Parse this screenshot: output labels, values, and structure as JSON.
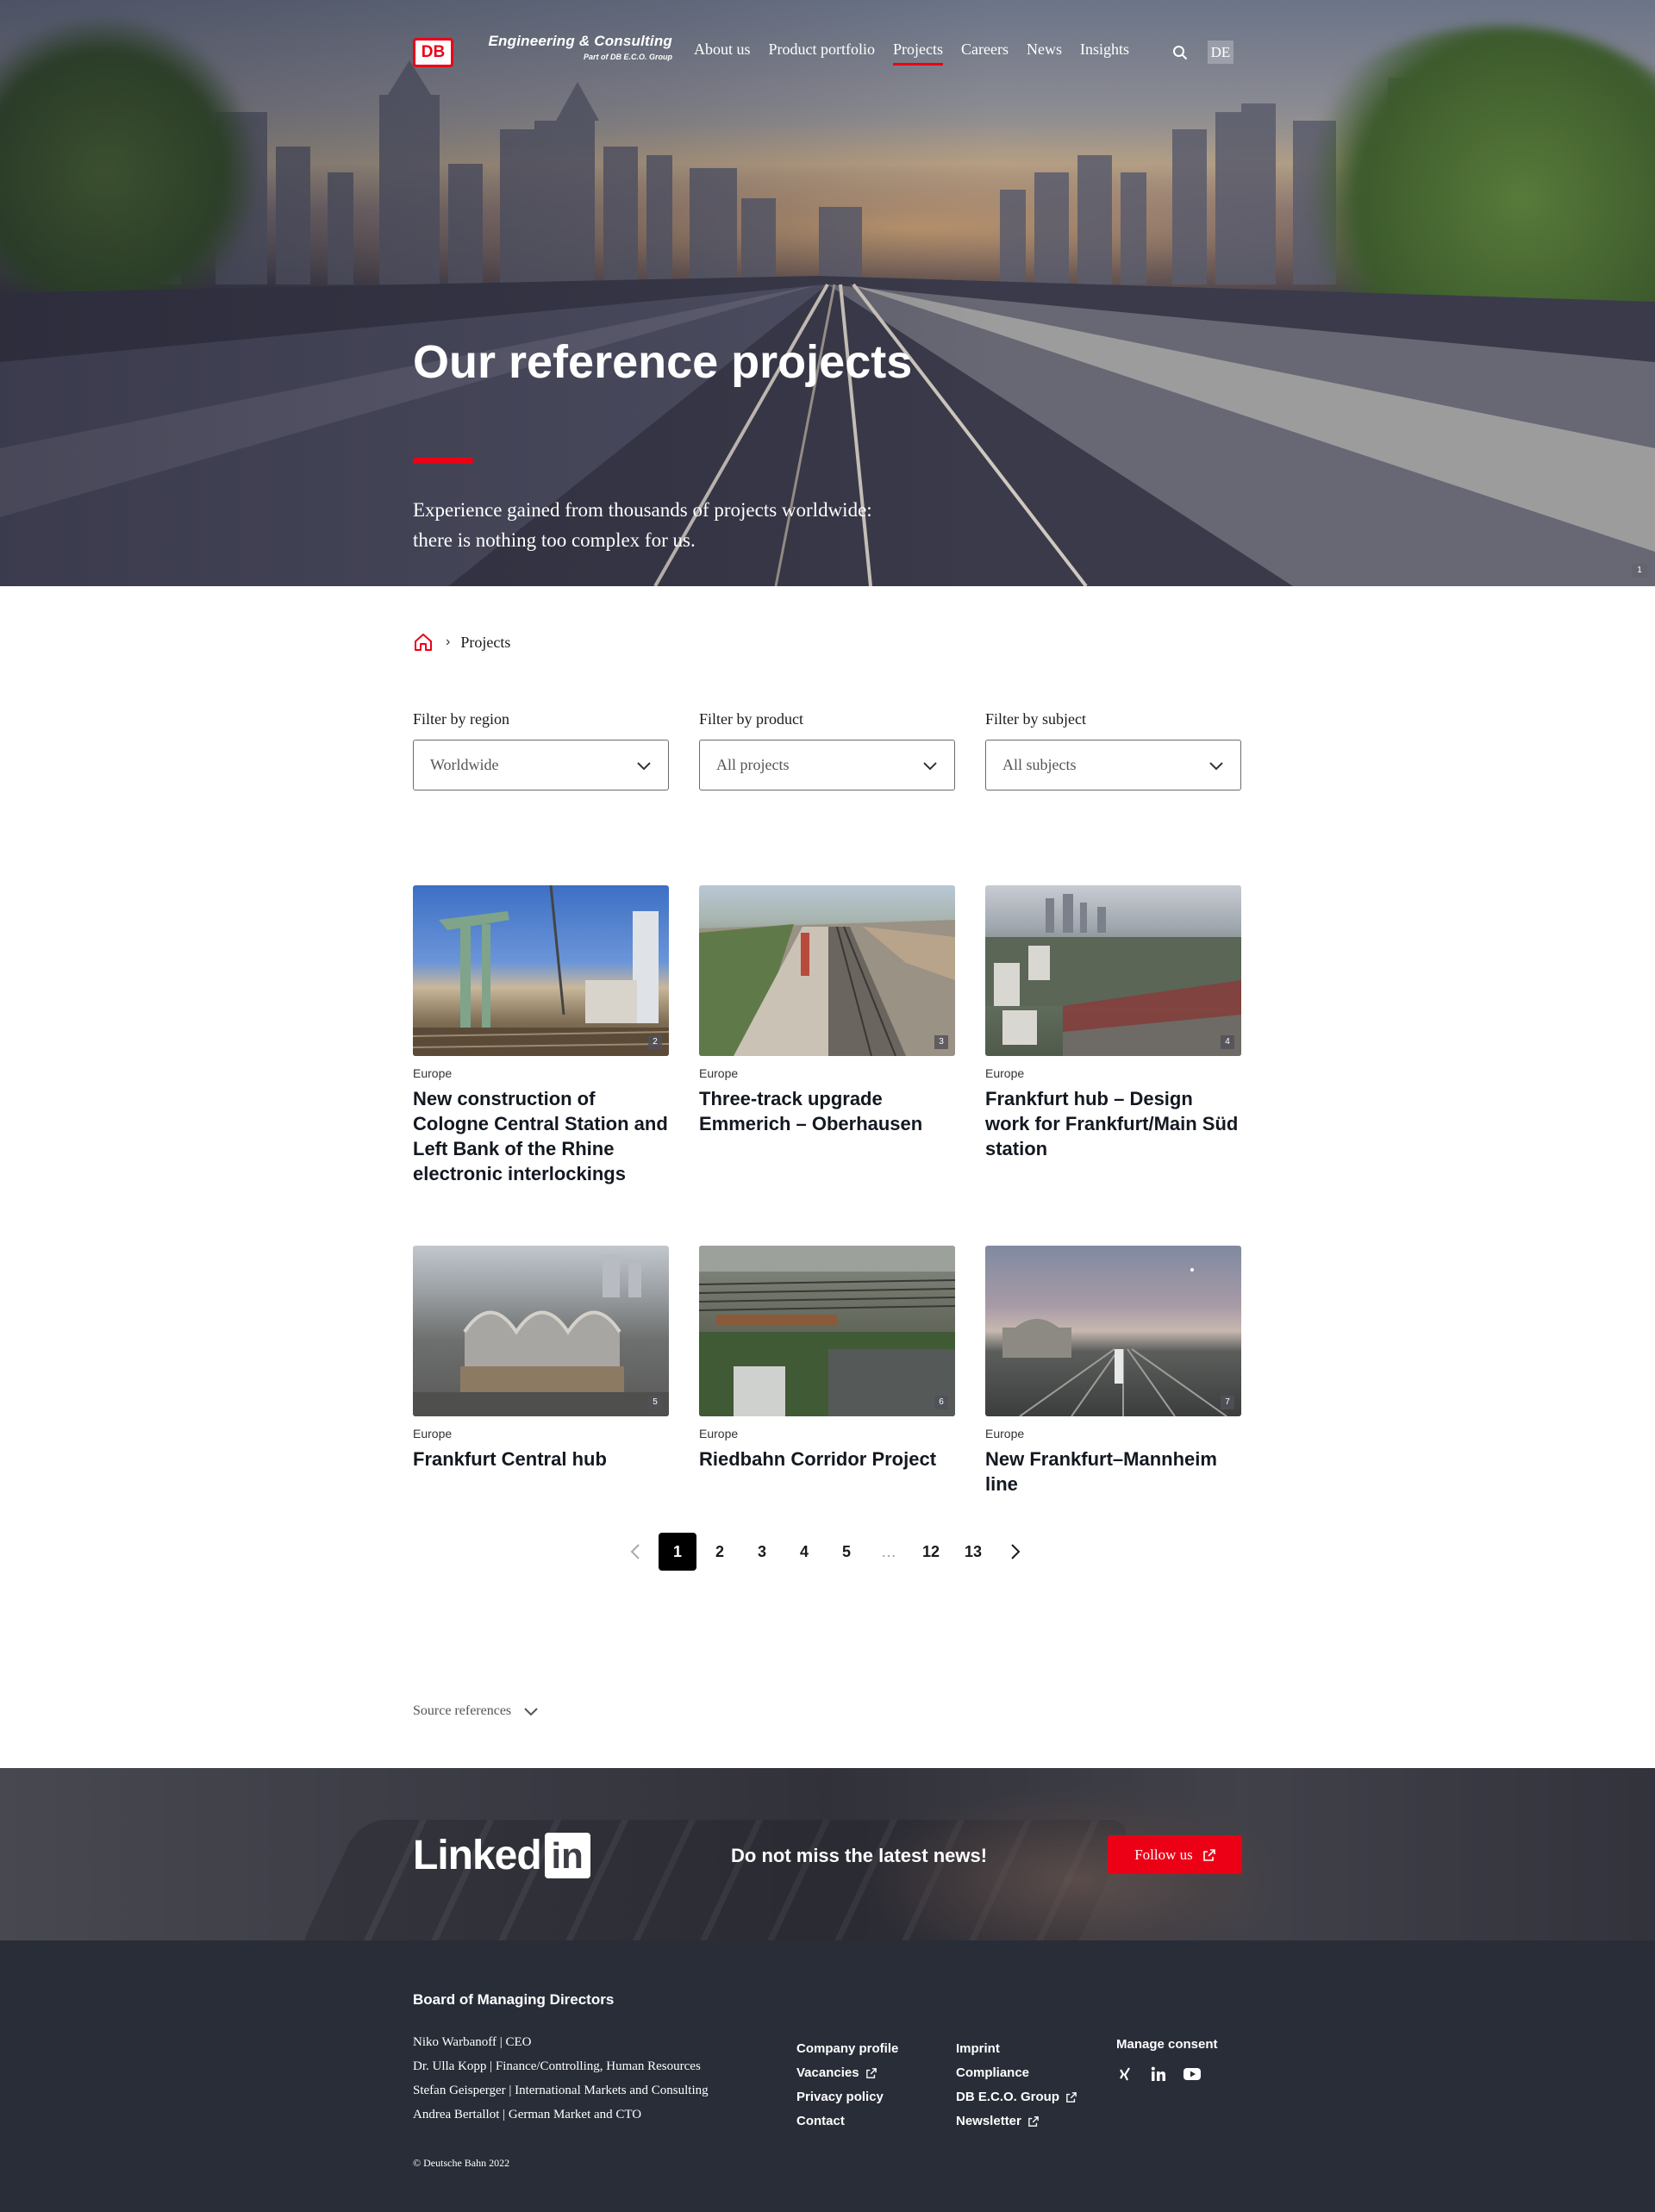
{
  "header": {
    "logo_text": "DB",
    "brand": "Engineering & Consulting",
    "brand_sub": "Part of DB E.C.O. Group",
    "nav": [
      {
        "label": "About us",
        "active": false
      },
      {
        "label": "Product portfolio",
        "active": false
      },
      {
        "label": "Projects",
        "active": true
      },
      {
        "label": "Careers",
        "active": false
      },
      {
        "label": "News",
        "active": false
      },
      {
        "label": "Insights",
        "active": false
      }
    ],
    "search_icon": "search-icon",
    "language": "DE"
  },
  "hero": {
    "title": "Our reference projects",
    "subtitle": "Experience gained from thousands of projects worldwide: there is nothing too complex for us.",
    "image_number": "1"
  },
  "breadcrumb": {
    "home_icon": "home-icon",
    "current": "Projects"
  },
  "filters": [
    {
      "label": "Filter by region",
      "value": "Worldwide"
    },
    {
      "label": "Filter by product",
      "value": "All projects"
    },
    {
      "label": "Filter by subject",
      "value": "All subjects"
    }
  ],
  "projects": [
    {
      "region": "Europe",
      "title": "New construction of Cologne Central Station and Left Bank of the Rhine electronic interlockings",
      "image_number": "2"
    },
    {
      "region": "Europe",
      "title": "Three-track upgrade Emmerich – Oberhausen",
      "image_number": "3"
    },
    {
      "region": "Europe",
      "title": "Frankfurt hub – Design work for Frankfurt/Main Süd station",
      "image_number": "4"
    },
    {
      "region": "Europe",
      "title": "Frankfurt Central hub",
      "image_number": "5"
    },
    {
      "region": "Europe",
      "title": "Riedbahn Corridor Project",
      "image_number": "6"
    },
    {
      "region": "Europe",
      "title": "New Frankfurt–Mannheim line",
      "image_number": "7"
    }
  ],
  "pagination": {
    "pages": [
      "1",
      "2",
      "3",
      "4",
      "5",
      "…",
      "12",
      "13"
    ],
    "current": "1"
  },
  "sources_label": "Source references",
  "linkedin": {
    "logo_text": "Linked",
    "logo_box": "in",
    "message": "Do not miss the latest news!",
    "button": "Follow us"
  },
  "footer": {
    "board_title": "Board of Managing Directors",
    "board": [
      "Niko Warbanoff | CEO",
      "Dr. Ulla Kopp | Finance/Controlling, Human Resources",
      "Stefan Geisperger | International Markets and Consulting",
      "Andrea Bertallot | German Market and CTO"
    ],
    "col1": [
      "Company profile",
      "Vacancies",
      "Privacy policy",
      "Contact"
    ],
    "col2": [
      "Imprint",
      "Compliance",
      "DB E.C.O. Group",
      "Newsletter"
    ],
    "consent": "Manage consent",
    "social": [
      "xing-icon",
      "linkedin-icon",
      "youtube-icon"
    ],
    "copyright": "© Deutsche Bahn 2022"
  },
  "colors": {
    "accent": "#ec0016",
    "footer_bg": "#282d37"
  }
}
